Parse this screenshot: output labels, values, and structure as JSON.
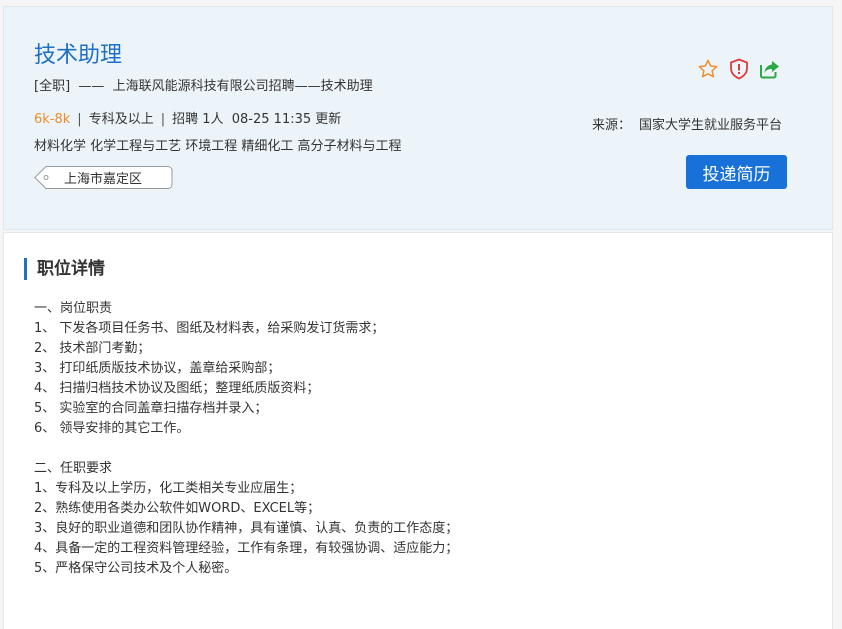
{
  "job": {
    "title": "技术助理",
    "subtitle": "[全职]  ——  上海联风能源科技有限公司招聘——技术助理",
    "salary": "6k-8k",
    "education": "专科及以上",
    "headcount": "招聘 1人",
    "updated": "08-25 11:35 更新",
    "majors": "材料化学 化学工程与工艺 环境工程 精细化工 高分子材料与工程",
    "location": "上海市嘉定区",
    "source_label": "来源：",
    "source_value": "国家大学生就业服务平台",
    "apply_label": "投递简历"
  },
  "icons": {
    "favorite": "star-icon",
    "report": "shield-alert-icon",
    "share": "share-icon"
  },
  "colors": {
    "title": "#1f6fc5",
    "salary": "#f08c2b",
    "apply_button": "#1771d8",
    "star": "#f08c2b",
    "report": "#e03a3a",
    "share": "#2aa845"
  },
  "details": {
    "heading": "职位详情",
    "responsibilities": [
      "一、岗位职责",
      "1、 下发各项目任务书、图纸及材料表，给采购发订货需求；",
      "2、 技术部门考勤；",
      "3、 打印纸质版技术协议，盖章给采购部；",
      "4、 扫描归档技术协议及图纸；整理纸质版资料；",
      "5、 实验室的合同盖章扫描存档并录入；",
      "6、 领导安排的其它工作。"
    ],
    "requirements": [
      "二、任职要求",
      "1、专科及以上学历，化工类相关专业应届生；",
      "2、熟练使用各类办公软件如WORD、EXCEL等；",
      "3、良好的职业道德和团队协作精神，具有谨慎、认真、负责的工作态度；",
      "4、具备一定的工程资料管理经验，工作有条理，有较强协调、适应能力；",
      "5、严格保守公司技术及个人秘密。"
    ]
  }
}
